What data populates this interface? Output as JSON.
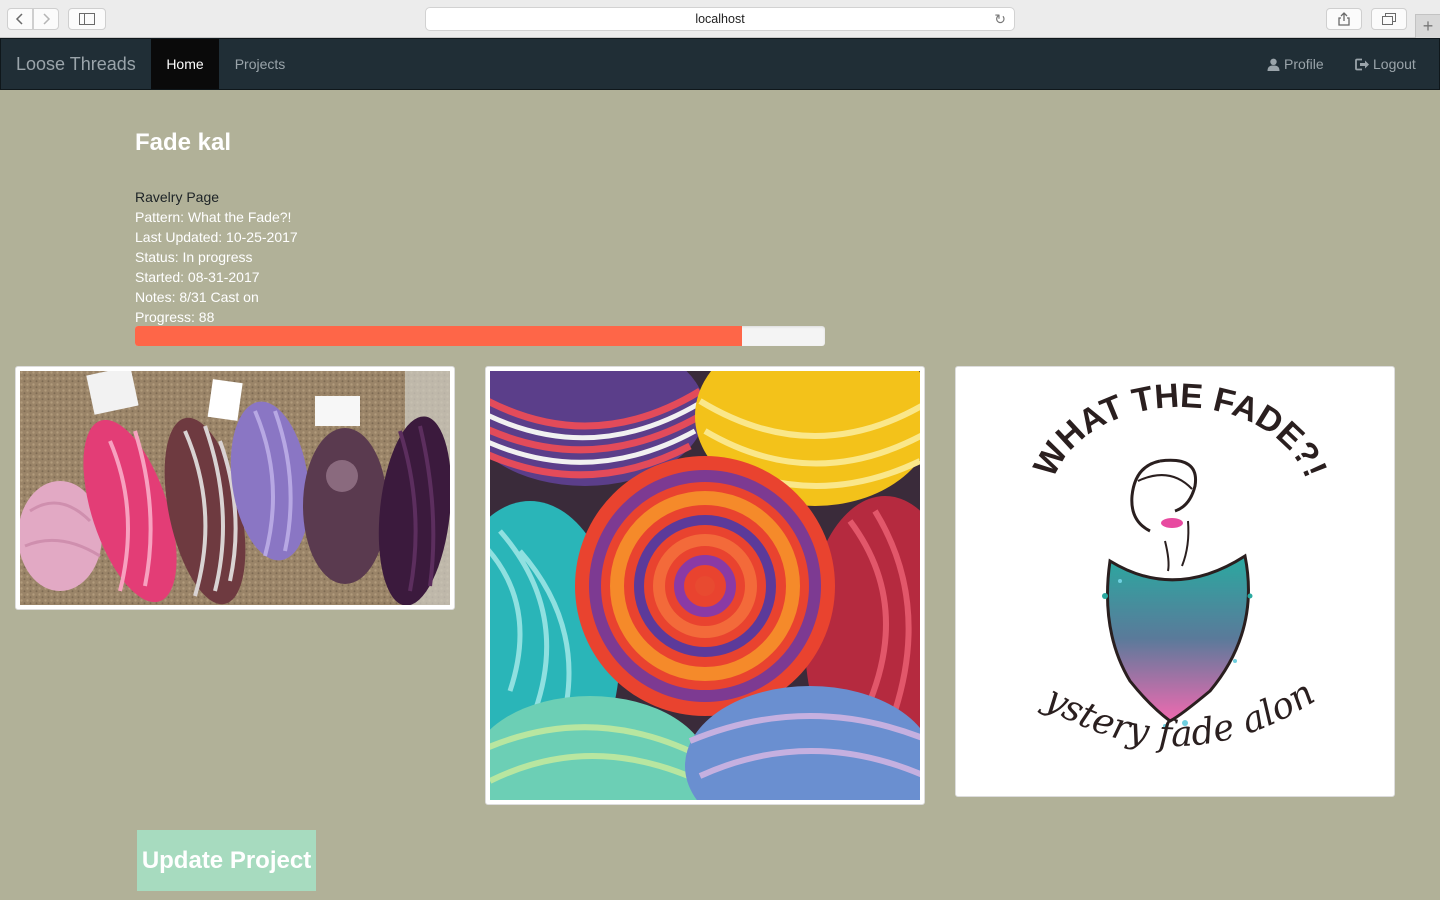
{
  "browser": {
    "url": "localhost"
  },
  "navbar": {
    "brand": "Loose Threads",
    "home_label": "Home",
    "projects_label": "Projects",
    "profile_label": "Profile",
    "logout_label": "Logout",
    "background_color": "#202e36",
    "active_color": "#0a0a0a"
  },
  "project": {
    "title": "Fade kal",
    "ravelry_link": "Ravelry Page",
    "pattern": "Pattern: What the Fade?!",
    "last_updated": "Last Updated: 10-25-2017",
    "status": "Status: In progress",
    "started": "Started: 08-31-2017",
    "notes": "Notes: 8/31 Cast on",
    "progress_label": "Progress: 88",
    "progress_value": 88,
    "progress_color": "#fe6648"
  },
  "logo": {
    "top_text": "WHAT THE FADE?!",
    "bottom_text": "mystery fade along"
  },
  "actions": {
    "update_label": "Update Project",
    "update_color": "#a7dbbf"
  },
  "theme": {
    "page_background": "#b1b198"
  }
}
